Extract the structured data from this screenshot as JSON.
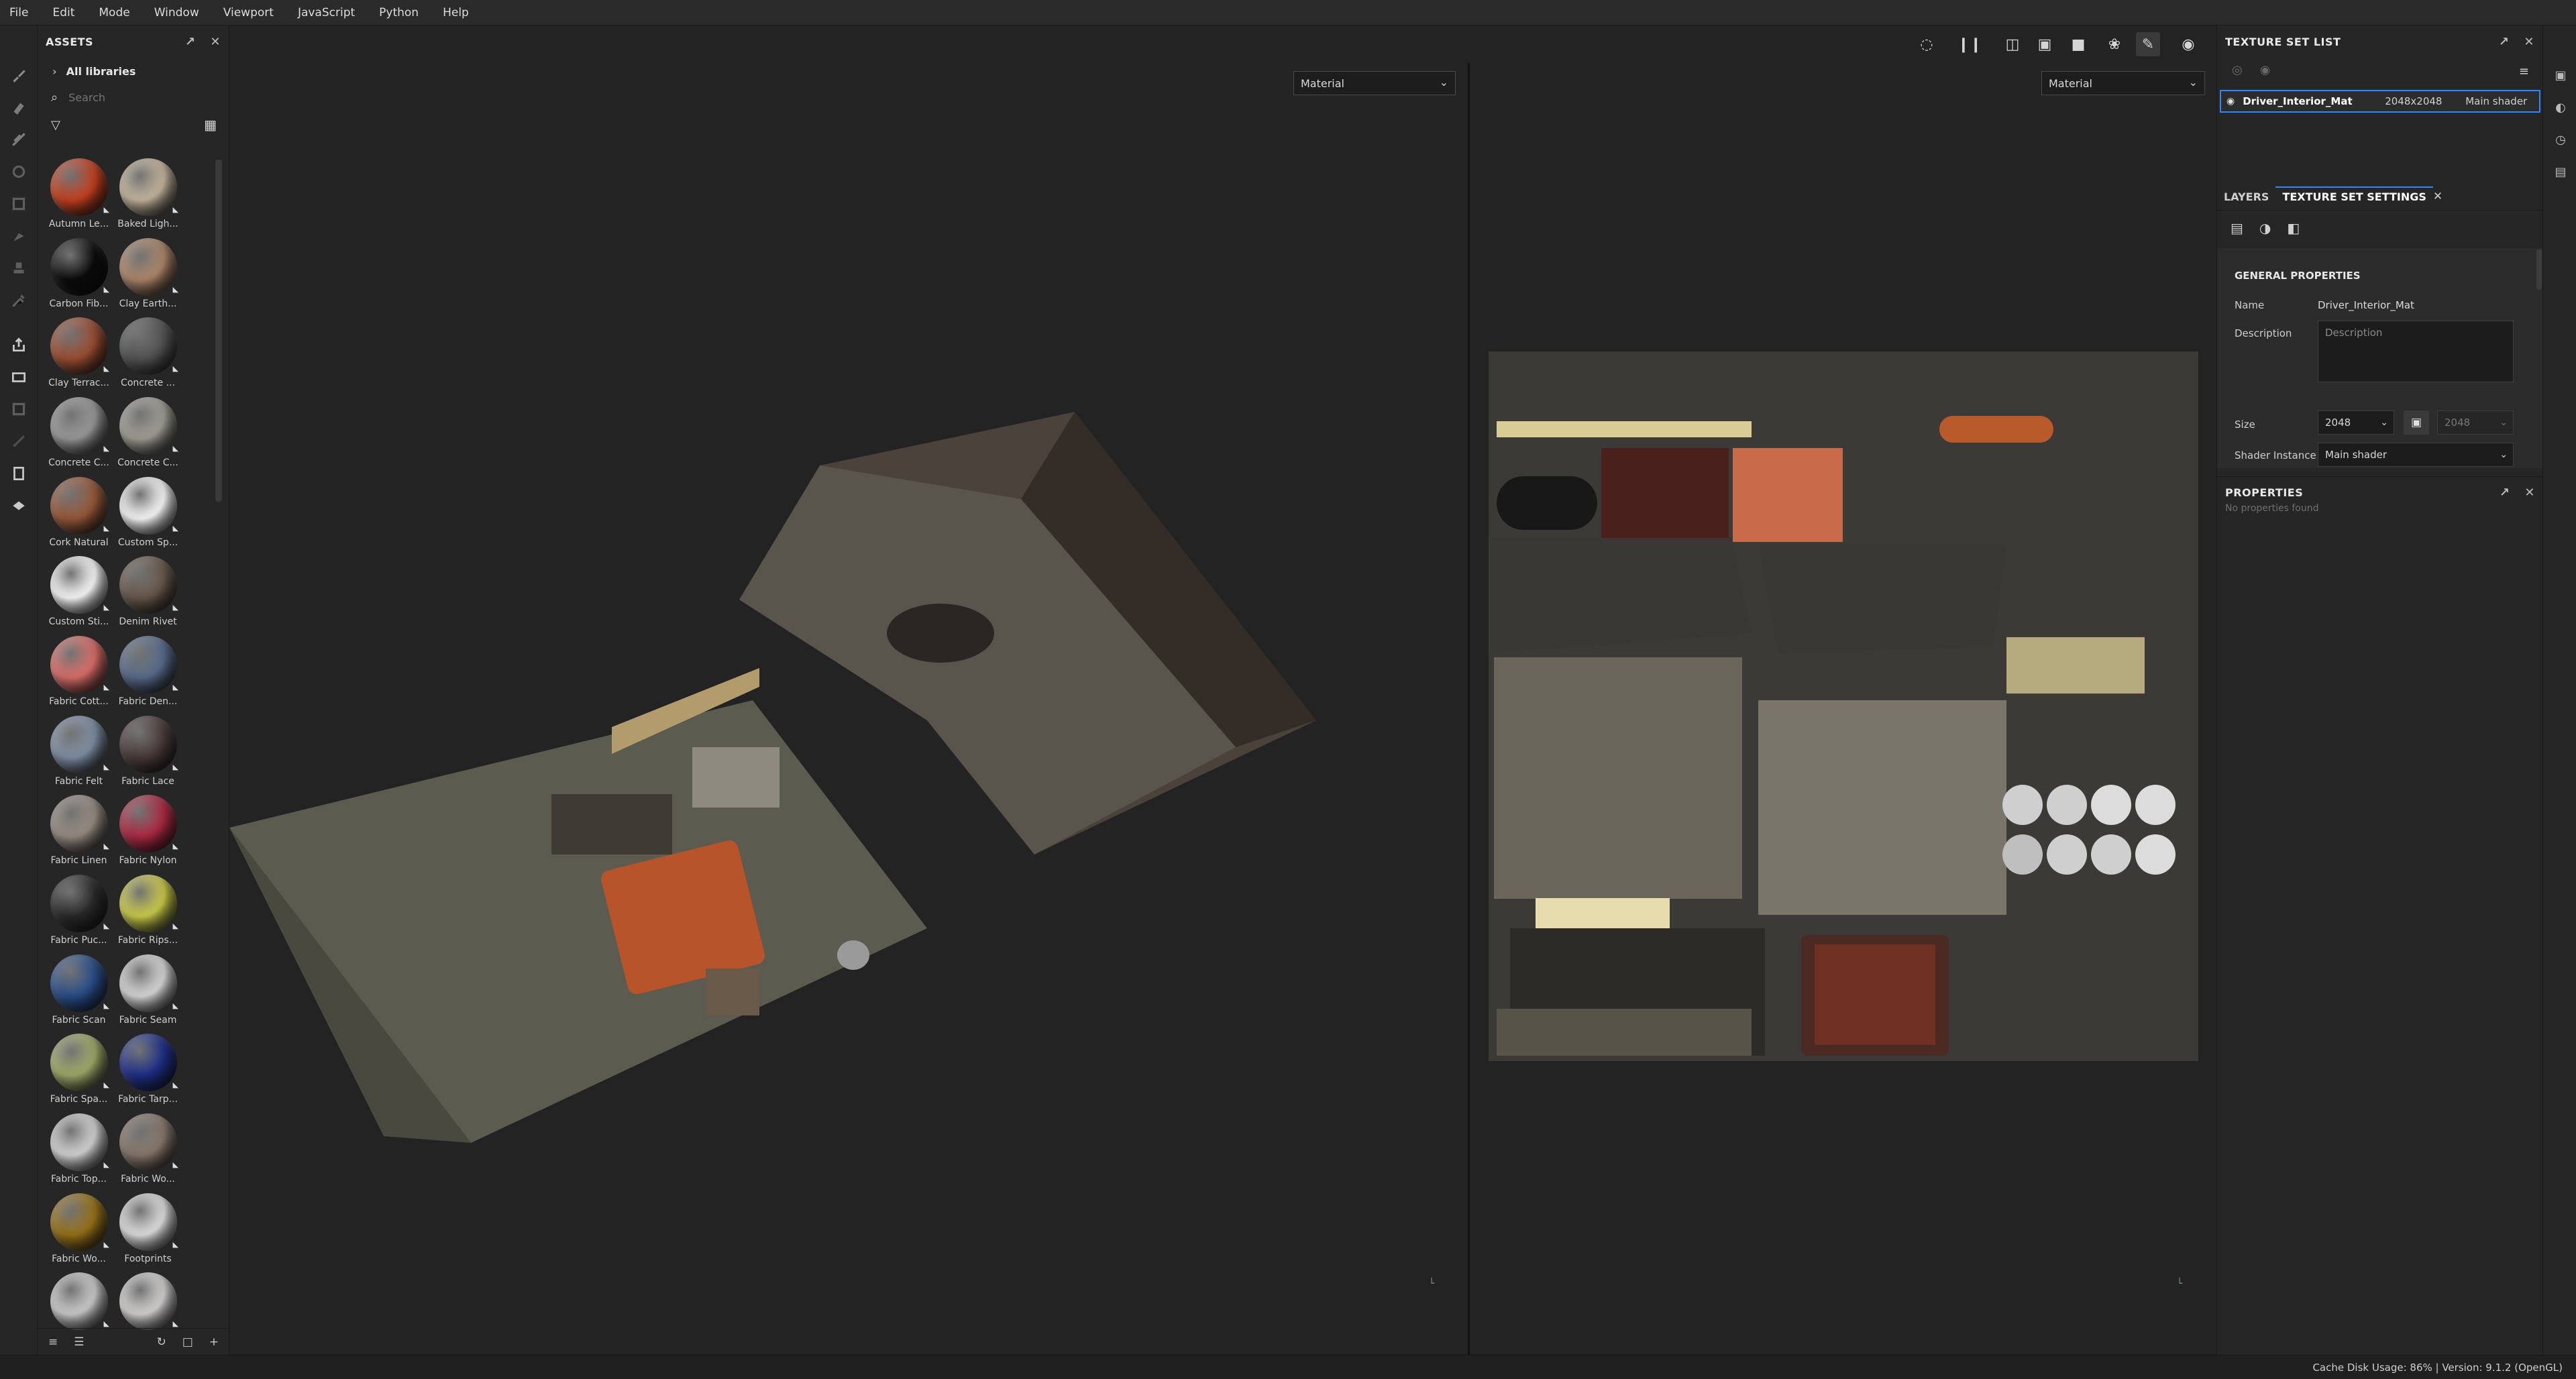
{
  "menu": [
    "File",
    "Edit",
    "Mode",
    "Window",
    "Viewport",
    "JavaScript",
    "Python",
    "Help"
  ],
  "assets": {
    "title": "ASSETS",
    "library": "All libraries",
    "search_placeholder": "Search",
    "items": [
      {
        "label": "Autumn Le...",
        "color": "#c8411f"
      },
      {
        "label": "Baked Ligh...",
        "color": "#c9b9a0"
      },
      {
        "label": "Carbon Fib...",
        "color": "#0b0b0b"
      },
      {
        "label": "Clay Earth...",
        "color": "#b0896c"
      },
      {
        "label": "Clay Terrac...",
        "color": "#9e4f33"
      },
      {
        "label": "Concrete ...",
        "color": "#555555"
      },
      {
        "label": "Concrete C...",
        "color": "#9c9c9c"
      },
      {
        "label": "Concrete C...",
        "color": "#a3a197"
      },
      {
        "label": "Cork Natural",
        "color": "#9a5a3a"
      },
      {
        "label": "Custom Sp...",
        "color": "#ffffff"
      },
      {
        "label": "Custom Sti...",
        "color": "#ffffff"
      },
      {
        "label": "Denim Rivet",
        "color": "#6a5a4c"
      },
      {
        "label": "Fabric Cott...",
        "color": "#e0706a"
      },
      {
        "label": "Fabric Den...",
        "color": "#5a6e8e"
      },
      {
        "label": "Fabric Felt",
        "color": "#8292a8"
      },
      {
        "label": "Fabric Lace",
        "color": "#4a3a3a"
      },
      {
        "label": "Fabric Linen",
        "color": "#9a8f85"
      },
      {
        "label": "Fabric Nylon",
        "color": "#b02a44"
      },
      {
        "label": "Fabric Puc...",
        "color": "#2a2a2a"
      },
      {
        "label": "Fabric Rips...",
        "color": "#cfd04a"
      },
      {
        "label": "Fabric Scan",
        "color": "#2a4f8c"
      },
      {
        "label": "Fabric Seam",
        "color": "#dcdcdc"
      },
      {
        "label": "Fabric Spa...",
        "color": "#a3ad6a"
      },
      {
        "label": "Fabric Tarp...",
        "color": "#1f2f8a"
      },
      {
        "label": "Fabric Top...",
        "color": "#d8d8d8"
      },
      {
        "label": "Fabric Wo...",
        "color": "#8a7a6e"
      },
      {
        "label": "Fabric Wo...",
        "color": "#9a7418"
      },
      {
        "label": "Footprints",
        "color": "#e4e4e4"
      },
      {
        "label": "",
        "color": "#d0d0d0"
      },
      {
        "label": "",
        "color": "#dad6d6"
      }
    ]
  },
  "viewport": {
    "left_mode": "Material",
    "right_mode": "Material"
  },
  "texture_set_list": {
    "title": "TEXTURE SET LIST",
    "row": {
      "name": "Driver_Interior_Mat",
      "size": "2048x2048",
      "shader": "Main shader"
    }
  },
  "tabs": {
    "layers": "LAYERS",
    "settings": "TEXTURE SET SETTINGS"
  },
  "general": {
    "heading": "GENERAL PROPERTIES",
    "name_label": "Name",
    "name_value": "Driver_Interior_Mat",
    "desc_label": "Description",
    "desc_placeholder": "Description",
    "size_label": "Size",
    "size_value": "2048",
    "size_value2": "2048",
    "shader_label": "Shader Instance",
    "shader_value": "Main shader"
  },
  "properties": {
    "title": "PROPERTIES",
    "empty": "No properties found"
  },
  "status": "Cache Disk Usage:    86% | Version: 9.1.2 (OpenGL)",
  "colors": {
    "accent": "#2f86ff",
    "panel": "#262626",
    "viewport": "#232323"
  }
}
